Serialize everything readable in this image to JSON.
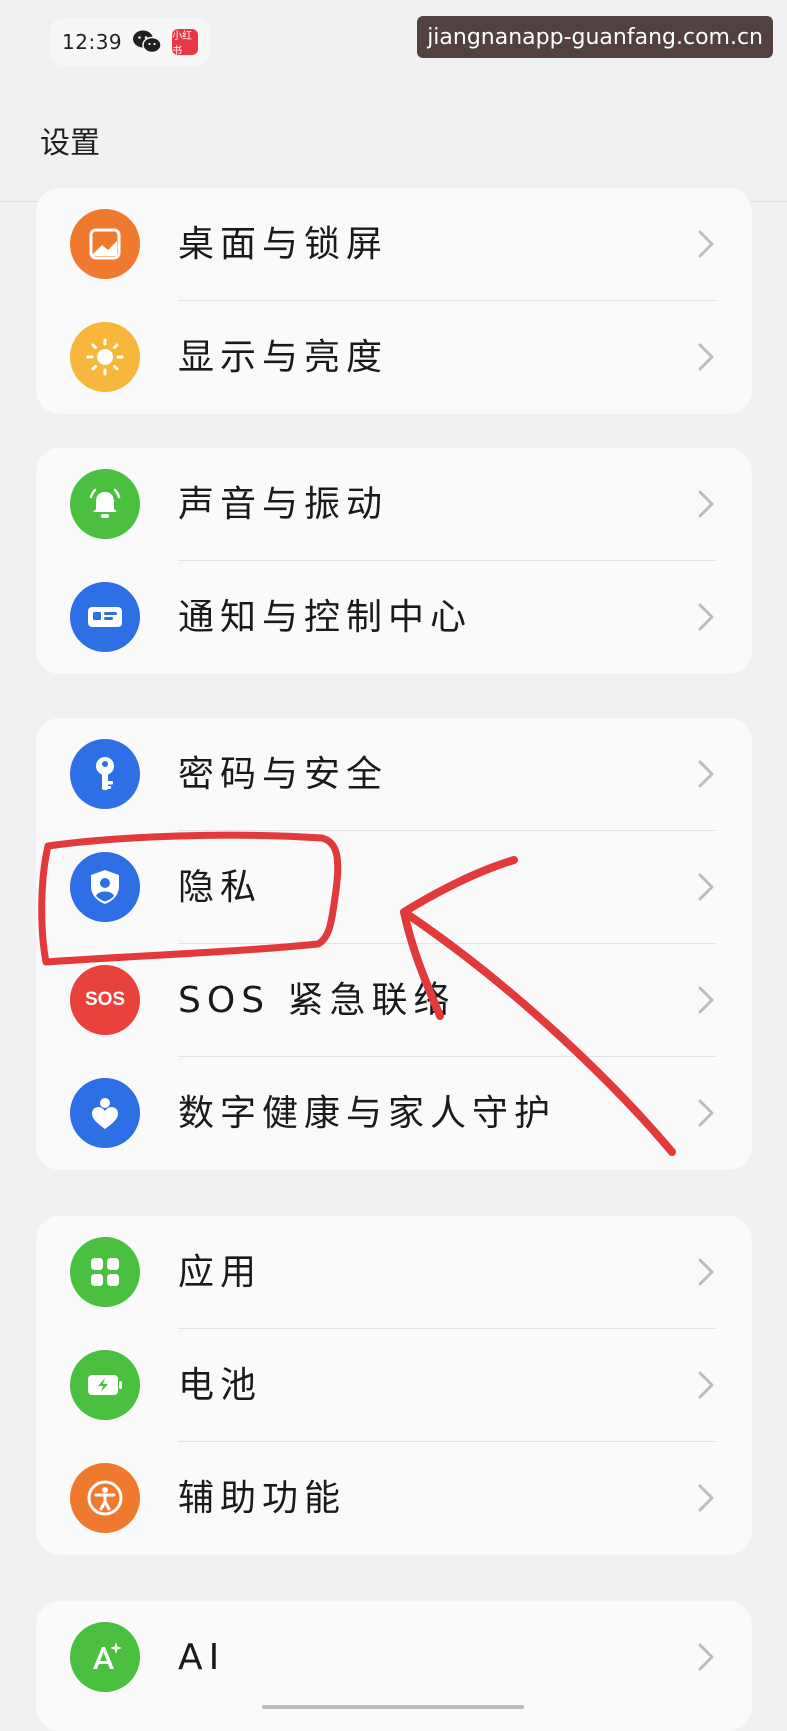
{
  "status_bar": {
    "time": "12:39",
    "app_badge": "小红书"
  },
  "watermark": "jiangnanapp-guanfang.com.cn",
  "page_title": "设置",
  "groups": [
    {
      "items": [
        {
          "label": "桌面与锁屏",
          "icon": "wallpaper-icon",
          "color": "#ef7a2f"
        },
        {
          "label": "显示与亮度",
          "icon": "sun-icon",
          "color": "#f6b73c"
        }
      ]
    },
    {
      "items": [
        {
          "label": "声音与振动",
          "icon": "bell-icon",
          "color": "#4bbf3f"
        },
        {
          "label": "通知与控制中心",
          "icon": "notification-card-icon",
          "color": "#2f6fe6"
        }
      ]
    },
    {
      "items": [
        {
          "label": "密码与安全",
          "icon": "key-icon",
          "color": "#2f6fe6"
        },
        {
          "label": "隐私",
          "icon": "shield-user-icon",
          "color": "#2f6fe6"
        },
        {
          "label": "SOS 紧急联络",
          "icon": "sos-icon",
          "icon_text": "SOS",
          "color": "#e8423a"
        },
        {
          "label": "数字健康与家人守护",
          "icon": "heart-person-icon",
          "color": "#2f6fe6"
        }
      ]
    },
    {
      "items": [
        {
          "label": "应用",
          "icon": "apps-grid-icon",
          "color": "#4bbf3f"
        },
        {
          "label": "电池",
          "icon": "battery-icon",
          "color": "#4bbf3f"
        },
        {
          "label": "辅助功能",
          "icon": "accessibility-icon",
          "color": "#ef7a2f"
        }
      ]
    },
    {
      "items": [
        {
          "label": "AI",
          "icon": "ai-sparkle-icon",
          "color": "#4bbf3f"
        }
      ]
    }
  ],
  "annotation_color": "#e23a3a"
}
